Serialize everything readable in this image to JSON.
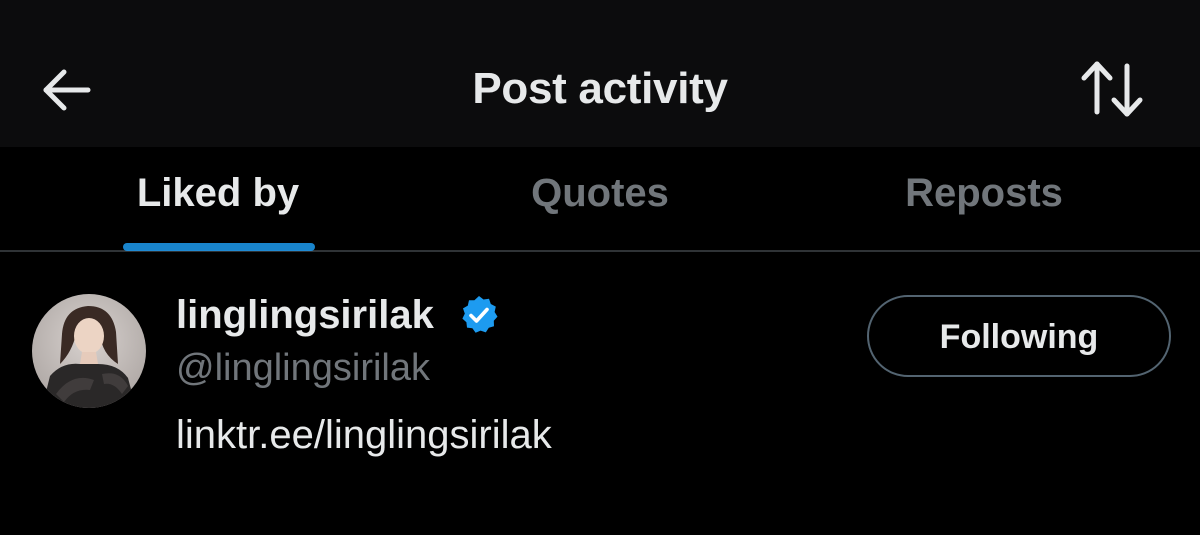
{
  "header": {
    "title": "Post activity",
    "back_icon": "arrow-left-icon",
    "sort_icon": "sort-arrows-icon"
  },
  "tabs": [
    {
      "label": "Liked by",
      "active": true
    },
    {
      "label": "Quotes",
      "active": false
    },
    {
      "label": "Reposts",
      "active": false
    }
  ],
  "users": [
    {
      "display_name": "linglingsirilak",
      "verified": true,
      "handle": "@linglingsirilak",
      "bio": "linktr.ee/linglingsirilak",
      "follow_label": "Following"
    }
  ],
  "colors": {
    "background": "#000000",
    "header_background": "#0c0c0d",
    "primary_text": "#e7e9ea",
    "secondary_text": "#71767b",
    "accent": "#1d9bf0",
    "divider": "#2f3336",
    "button_border": "#536471"
  }
}
